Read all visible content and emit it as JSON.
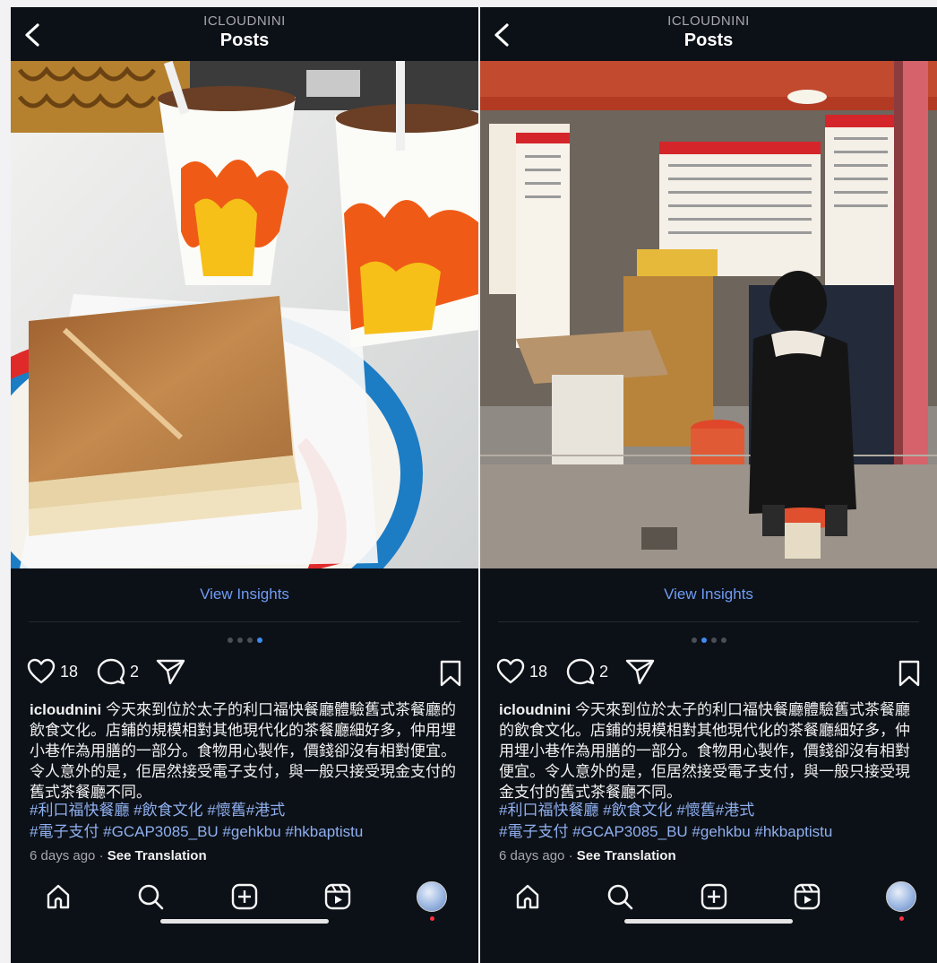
{
  "panels": [
    {
      "header": {
        "username": "ICLOUDNINI",
        "title": "Posts"
      },
      "photo": {
        "description_icon": "toast-and-milk-tea-photo"
      },
      "insights_label": "View Insights",
      "carousel": {
        "total": 4,
        "active": 4
      },
      "actions": {
        "likes": "18",
        "comments": "2"
      },
      "caption": {
        "username": "icloudnini",
        "text": "今天來到位於太子的利口福快餐廳體驗舊式茶餐廳的飲食文化。店鋪的規模相對其他現代化的茶餐廳細好多，仲用埋小巷作為用膳的一部分。食物用心製作，價錢卻沒有相對便宜。令人意外的是，佢居然接受電子支付，與一般只接受現金支付的舊式茶餐廳不同。",
        "hashtags_line1": "#利口福快餐廳 #飲食文化 #懷舊#港式",
        "hashtags_line2": "#電子支付 #GCAP3085_BU #gehkbu #hkbaptistu"
      },
      "meta": {
        "time": "6 days ago",
        "separator": "·",
        "translate": "See Translation"
      }
    },
    {
      "header": {
        "username": "ICLOUDNINI",
        "title": "Posts"
      },
      "photo": {
        "description_icon": "cha-chaan-teng-storefront-photo"
      },
      "insights_label": "View Insights",
      "carousel": {
        "total": 4,
        "active": 2
      },
      "actions": {
        "likes": "18",
        "comments": "2"
      },
      "caption": {
        "username": "icloudnini",
        "text": "今天來到位於太子的利口福快餐廳體驗舊式茶餐廳的飲食文化。店鋪的規模相對其他現代化的茶餐廳細好多，仲用埋小巷作為用膳的一部分。食物用心製作，價錢卻沒有相對便宜。令人意外的是，佢居然接受電子支付，與一般只接受現金支付的舊式茶餐廳不同。",
        "hashtags_line1": "#利口福快餐廳 #飲食文化 #懷舊#港式",
        "hashtags_line2": "#電子支付 #GCAP3085_BU #gehkbu #hkbaptistu"
      },
      "meta": {
        "time": "6 days ago",
        "separator": "·",
        "translate": "See Translation"
      }
    }
  ],
  "colors": {
    "background": "#0c1017",
    "link_blue": "#6f9df4",
    "hashtag": "#8fb0ef",
    "active_dot": "#3f8cf0",
    "notification": "#ff3040"
  },
  "nav_icons": [
    "home-icon",
    "search-icon",
    "create-post-icon",
    "reels-icon",
    "profile-avatar"
  ]
}
